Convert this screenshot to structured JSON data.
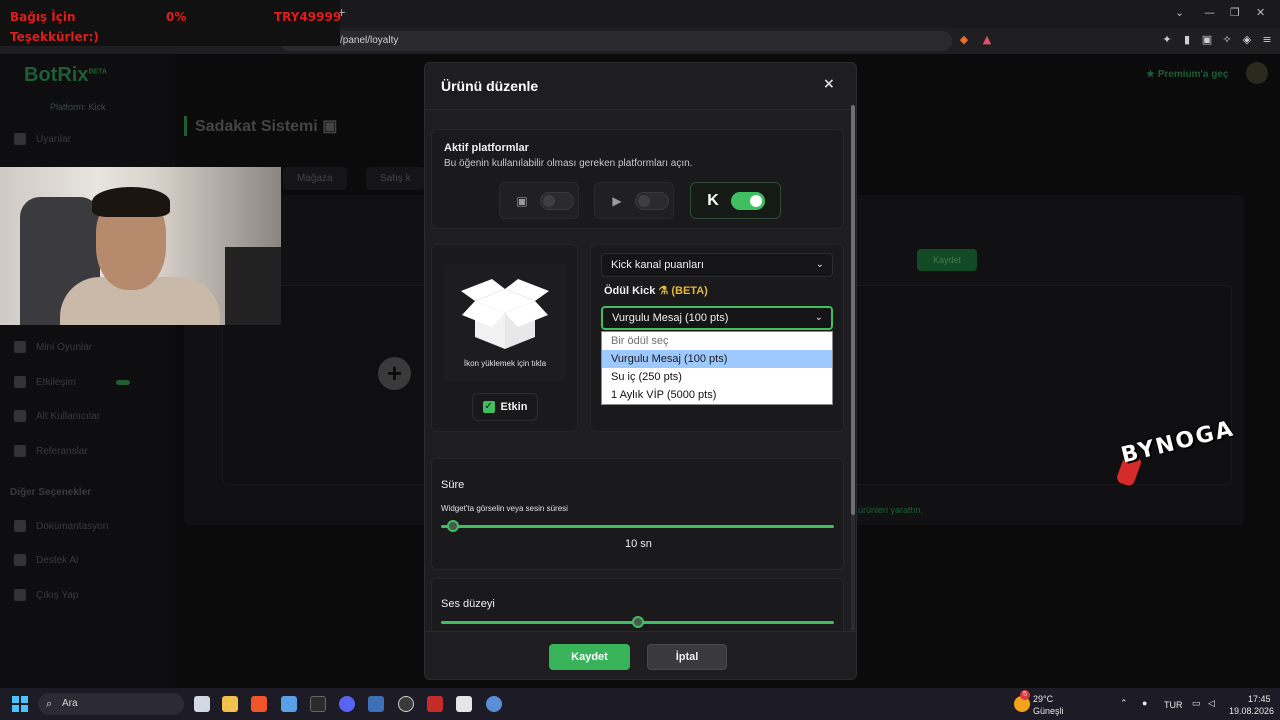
{
  "overlay": {
    "donate_label": "Bağış İçin",
    "percent": "0%",
    "amount": "TRY49999",
    "thanks": "Teşekkürler:)"
  },
  "browser": {
    "url": "/panel/loyalty",
    "tab_plus": "+"
  },
  "background": {
    "logo": "BotRix",
    "logo_badge": "BETA",
    "platform_label": "Platform: Kick",
    "page_title": "Sadakat Sistemi",
    "premium": "Premium'a geç",
    "tabs": [
      "Mağaza",
      "Satış k"
    ],
    "add_button": "Kaydet",
    "footnote": "ürünleri yarattın.",
    "sidebar_items": [
      {
        "label": "Uyarılar"
      },
      {
        "label": "Mini Oyunlar"
      },
      {
        "label": "Etkileşim"
      },
      {
        "label": "Alt Kullanıcılar"
      },
      {
        "label": "Referanslar"
      }
    ],
    "sidebar_section": "Diğer Seçenekler",
    "sidebar_other": [
      {
        "label": "Dokümantasyon"
      },
      {
        "label": "Destek Al"
      },
      {
        "label": "Çıkış Yap"
      }
    ]
  },
  "modal": {
    "title": "Ürünü düzenle",
    "close": "×",
    "platforms": {
      "heading": "Aktif platformlar",
      "description": "Bu öğenin kullanılabilir olması gereken platformları açın.",
      "items": [
        {
          "name": "Twitch",
          "icon": "twitch-icon",
          "enabled": false
        },
        {
          "name": "YouTube",
          "icon": "youtube-icon",
          "enabled": false
        },
        {
          "name": "Kick",
          "icon": "kick-icon",
          "glyph": "K",
          "enabled": true
        }
      ]
    },
    "icon_upload": {
      "hint": "İkon yüklemek için tıkla"
    },
    "enabled_checkbox": {
      "label": "Etkin",
      "checked": true
    },
    "points_select": {
      "value": "Kick kanal puanları"
    },
    "reward": {
      "label": "Ödül Kick",
      "beta": "(BETA)",
      "value": "Vurgulu Mesaj (100 pts)",
      "options": [
        {
          "label": "Bir ödül seç",
          "placeholder": true
        },
        {
          "label": "Vurgulu Mesaj (100 pts)",
          "selected": true
        },
        {
          "label": "Su iç (250 pts)"
        },
        {
          "label": "1 Aylık VİP (5000 pts)"
        }
      ]
    },
    "duration": {
      "heading": "Süre",
      "description": "Widget'ta görselin veya sesin süresi",
      "value_text": "10 sn",
      "fraction": 0.03
    },
    "volume": {
      "heading": "Ses düzeyi",
      "fraction": 0.5
    },
    "save": "Kaydet",
    "cancel": "İptal"
  },
  "watermark": "BYNOGA",
  "taskbar": {
    "search_placeholder": "Ara",
    "weather_temp": "29°C",
    "weather_desc": "Güneşli",
    "weather_badge": "5",
    "language": "TUR",
    "time": "17:45",
    "date": "19.08.2026"
  },
  "colors": {
    "accent": "#3fbf5f",
    "beta": "#e5b73b",
    "overlay_text": "#e21b1b"
  }
}
